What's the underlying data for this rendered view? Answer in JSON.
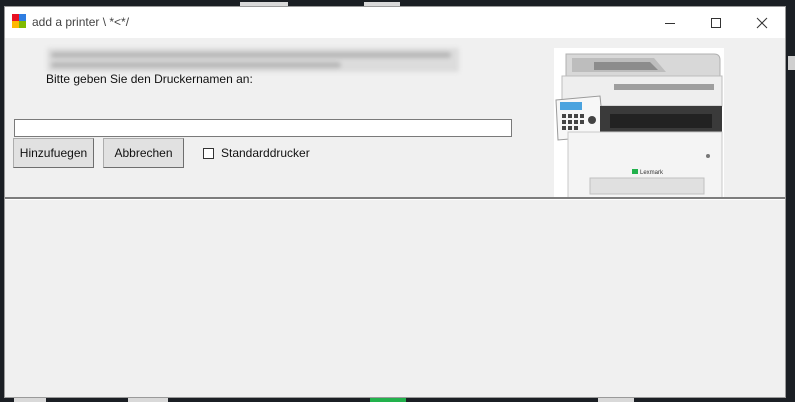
{
  "window": {
    "title": "add a printer \\ *<*/",
    "controls": [
      "minimize-icon",
      "maximize-icon",
      "close-icon"
    ]
  },
  "form": {
    "prompt_label": "Bitte geben Sie den Druckernamen an:",
    "printer_name_value": "",
    "add_button_label": "Hinzufuegen",
    "cancel_button_label": "Abbrechen",
    "default_printer_checkbox_label": "Standarddrucker",
    "default_printer_checked": false
  },
  "image": {
    "brand_text": "Lexmark"
  },
  "colors": {
    "window_bg": "#f0f0f0",
    "titlebar_bg": "#ffffff",
    "desktop_bg": "#1b1f24",
    "green_accent": "#22b14c"
  }
}
